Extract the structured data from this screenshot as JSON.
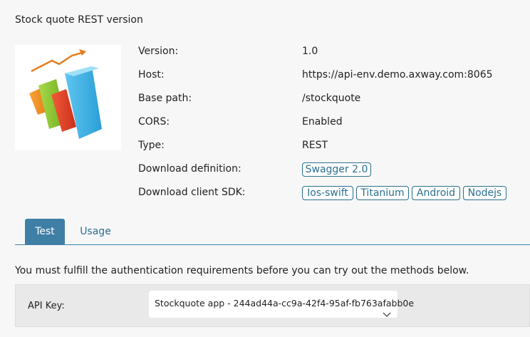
{
  "api": {
    "title": "Stock quote REST version"
  },
  "properties": [
    {
      "label": "Version:",
      "value": "1.0"
    },
    {
      "label": "Host:",
      "value": "https://api-env.demo.axway.com:8065"
    },
    {
      "label": "Base path:",
      "value": "/stockquote"
    },
    {
      "label": "CORS:",
      "value": "Enabled"
    },
    {
      "label": "Type:",
      "value": "REST"
    }
  ],
  "download_definition": {
    "label": "Download definition:",
    "links": [
      "Swagger 2.0"
    ]
  },
  "download_sdk": {
    "label": "Download client SDK:",
    "links": [
      "Ios-swift",
      "Titanium",
      "Android",
      "Nodejs"
    ]
  },
  "tabs": [
    {
      "label": "Test",
      "active": true
    },
    {
      "label": "Usage",
      "active": false
    }
  ],
  "notice": "You must fulfill the authentication requirements before you can try out the methods below.",
  "auth": {
    "label": "API Key:",
    "selected": "Stockquote app - 244ad44a-cc9a-42f4-95af-fb763afabb0e"
  },
  "colors": {
    "accent": "#3f7fa6",
    "link": "#2a6f8f",
    "background": "#f7f7f7"
  }
}
